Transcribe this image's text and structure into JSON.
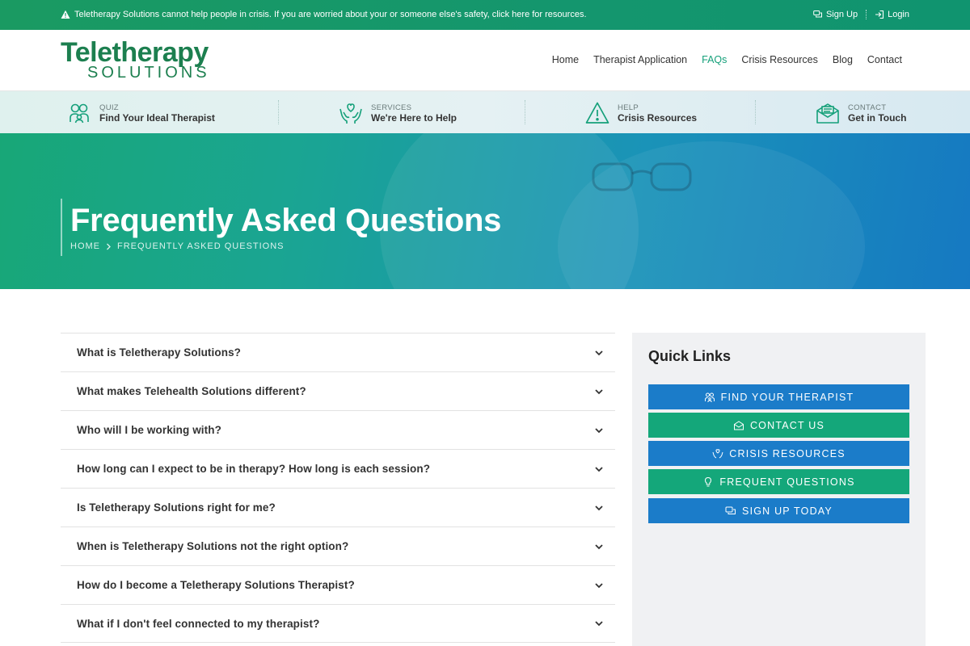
{
  "alert": {
    "text": "Teletherapy Solutions cannot help people in crisis. If you are worried about your or someone else's safety, click here for resources.",
    "signup": "Sign Up",
    "login": "Login"
  },
  "logo": {
    "top": "Teletherapy",
    "bottom": "SOLUTIONS"
  },
  "nav": [
    "Home",
    "Therapist Application",
    "FAQs",
    "Crisis Resources",
    "Blog",
    "Contact"
  ],
  "nav_active": "FAQs",
  "info": [
    {
      "category": "QUIZ",
      "label": "Find Your Ideal Therapist",
      "icon": "people-icon"
    },
    {
      "category": "SERVICES",
      "label": "We're Here to Help",
      "icon": "hands-heart-icon"
    },
    {
      "category": "HELP",
      "label": "Crisis Resources",
      "icon": "warning-icon"
    },
    {
      "category": "CONTACT",
      "label": "Get in Touch",
      "icon": "envelope-icon"
    }
  ],
  "hero": {
    "title": "Frequently Asked Questions",
    "crumb_home": "HOME",
    "crumb_current": "FREQUENTLY ASKED QUESTIONS"
  },
  "faqs": [
    "What is Teletherapy Solutions?",
    "What makes Telehealth Solutions different?",
    "Who will I be working with?",
    "How long can I expect to be in therapy? How long is each session?",
    "Is Teletherapy Solutions right for me?",
    "When is Teletherapy Solutions not the right option?",
    "How do I become a Teletherapy Solutions Therapist?",
    "What if I don't feel connected to my therapist?"
  ],
  "sidebar": {
    "title": "Quick Links",
    "links": [
      {
        "label": "FIND YOUR THERAPIST",
        "color": "#1b7cc9",
        "icon": "people-icon"
      },
      {
        "label": "CONTACT US",
        "color": "#14a77a",
        "icon": "envelope-icon"
      },
      {
        "label": "CRISIS RESOURCES",
        "color": "#1b7cc9",
        "icon": "hands-heart-icon"
      },
      {
        "label": "FREQUENT QUESTIONS",
        "color": "#14a77a",
        "icon": "lightbulb-icon"
      },
      {
        "label": "SIGN UP TODAY",
        "color": "#1b7cc9",
        "icon": "chat-icon"
      }
    ]
  },
  "colors": {
    "brand_green": "#1c7f4f",
    "accent_teal": "#15a07a",
    "button_blue": "#1b7cc9",
    "button_green": "#14a77a"
  }
}
